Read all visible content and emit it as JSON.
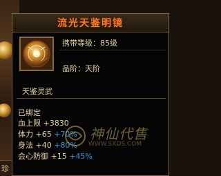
{
  "item": {
    "title": "流光天鉴明镜",
    "level_label": "携带等级：85级",
    "rank_label": "品阶：天阶",
    "subtitle": "天鉴灵武",
    "bound": "已绑定",
    "stats": [
      {
        "name": "血上限",
        "base": "+3830",
        "pct": ""
      },
      {
        "name": "体力",
        "base": "+65",
        "pct": "+70%"
      },
      {
        "name": "身法",
        "base": "+40",
        "pct": "+80%"
      },
      {
        "name": "会心防御",
        "base": "+15",
        "pct": "+45%"
      }
    ]
  },
  "background": {
    "corner_text": "珍"
  },
  "watermark": {
    "name": "神仙代售",
    "url": "WWW.SXDS.COM"
  },
  "colors": {
    "title": "#ff7a2a",
    "text": "#e6d3a3",
    "percent": "#3a9ad8",
    "border": "#7a6540"
  },
  "icons": {
    "item_icon": "bronze-mirror-icon"
  }
}
